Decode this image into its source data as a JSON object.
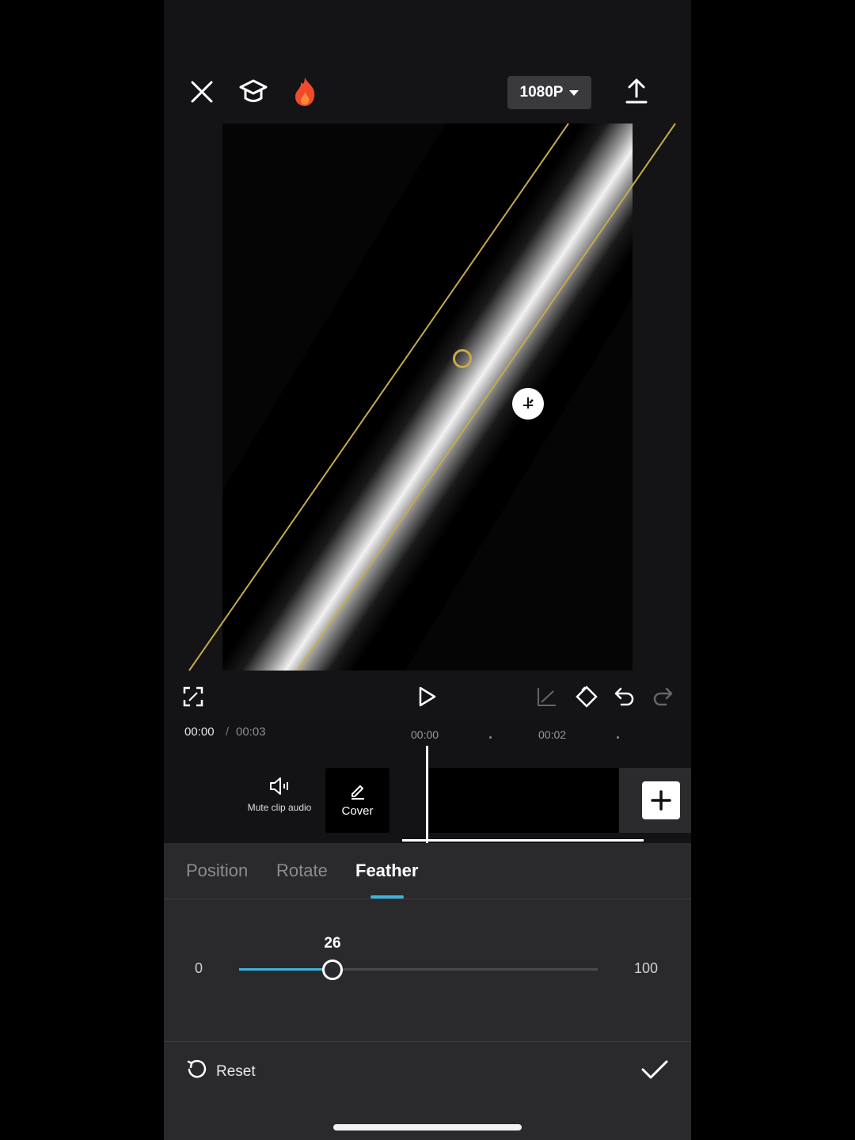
{
  "top_bar": {
    "close_icon": "close-icon",
    "tutorial_icon": "graduation-cap-icon",
    "trending_icon": "flame-icon",
    "resolution": "1080P",
    "export_icon": "upload-icon"
  },
  "preview": {
    "mask_type": "linear",
    "feather_handle_icon": "feather-handle-icon",
    "center_handle_icon": "rotate-center-icon"
  },
  "controls": {
    "fullscreen_icon": "fullscreen-icon",
    "play_icon": "play-icon",
    "keyframe_graph_icon": "keyframe-curve-icon",
    "keyframe_icon": "keyframe-icon",
    "undo_icon": "undo-icon",
    "redo_icon": "redo-icon"
  },
  "timeline": {
    "current_time": "00:00",
    "separator": "/",
    "total_time": "00:03",
    "ticks": [
      "00:00",
      "00:02"
    ],
    "mute_label": "Mute clip audio",
    "cover_label": "Cover",
    "add_clip_icon": "plus-icon"
  },
  "mask_panel": {
    "tabs": [
      {
        "label": "Position",
        "active": false
      },
      {
        "label": "Rotate",
        "active": false
      },
      {
        "label": "Feather",
        "active": true
      }
    ],
    "slider": {
      "min_label": "0",
      "max_label": "100",
      "value_label": "26",
      "value": 26,
      "max": 100
    },
    "reset_label": "Reset",
    "confirm_icon": "checkmark-icon"
  },
  "colors": {
    "accent": "#3bb4e0",
    "mask_line": "#c9a94a",
    "background": "#141416",
    "panel": "#2a2a2d"
  }
}
